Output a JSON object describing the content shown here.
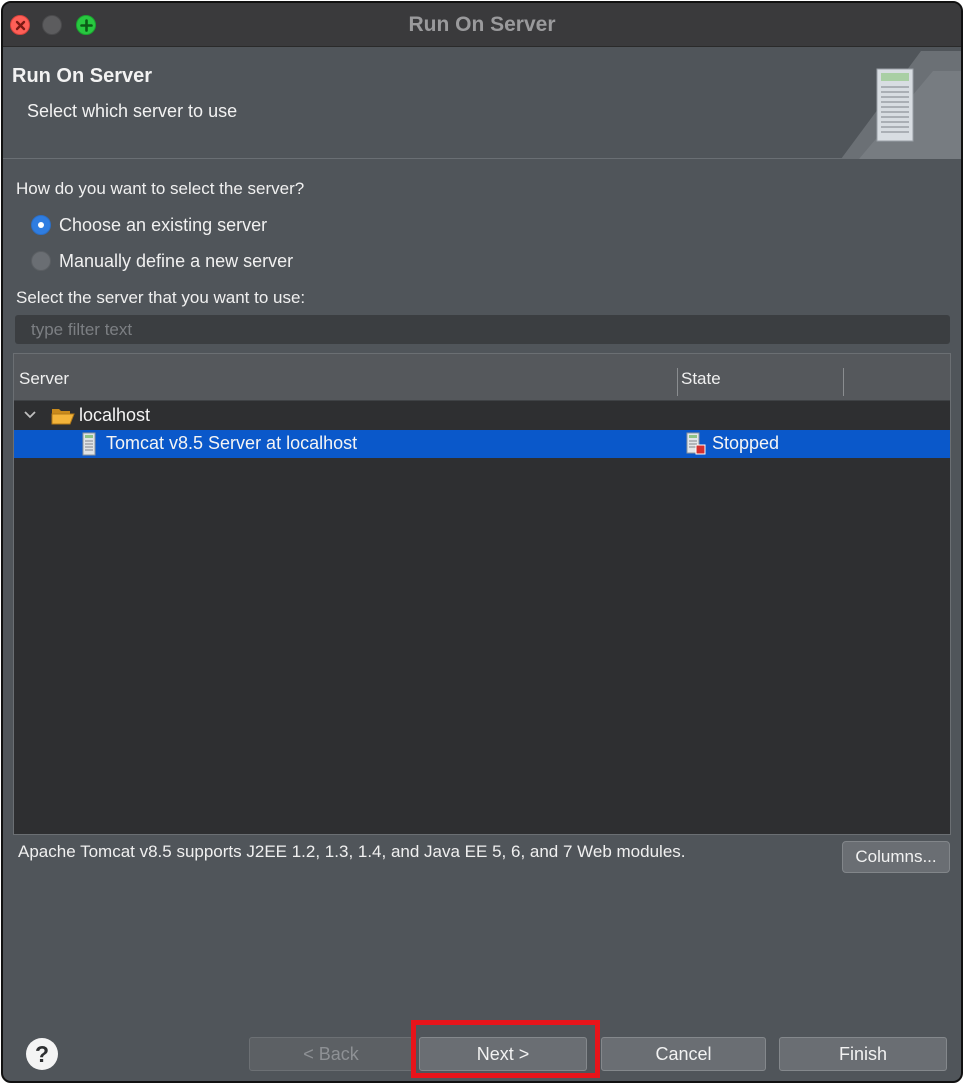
{
  "window": {
    "title": "Run On Server"
  },
  "banner": {
    "title": "Run On Server",
    "subtitle": "Select which server to use",
    "icon": "server-icon"
  },
  "selection": {
    "question": "How do you want to select the server?",
    "options": [
      {
        "label": "Choose an existing server",
        "checked": true
      },
      {
        "label": "Manually define a new server",
        "checked": false
      }
    ]
  },
  "server_list": {
    "label": "Select the server that you want to use:",
    "filter_placeholder": "type filter text",
    "filter_value": "",
    "columns": [
      "Server",
      "State"
    ],
    "group": {
      "name": "localhost",
      "expanded": true,
      "icon": "folder-open-icon"
    },
    "rows": [
      {
        "server": "Tomcat v8.5 Server at localhost",
        "state": "Stopped",
        "selected": true,
        "icon": "server-icon",
        "state_icon": "server-stopped-icon"
      }
    ]
  },
  "description": "Apache Tomcat v8.5 supports J2EE 1.2, 1.3, 1.4, and Java EE 5, 6, and 7 Web modules.",
  "buttons": {
    "columns": "Columns...",
    "help": "?",
    "back": "< Back",
    "next": "Next >",
    "cancel": "Cancel",
    "finish": "Finish"
  },
  "colors": {
    "selection": "#0a58ca",
    "accent": "#2f7de1",
    "highlight": "#e8141a"
  }
}
